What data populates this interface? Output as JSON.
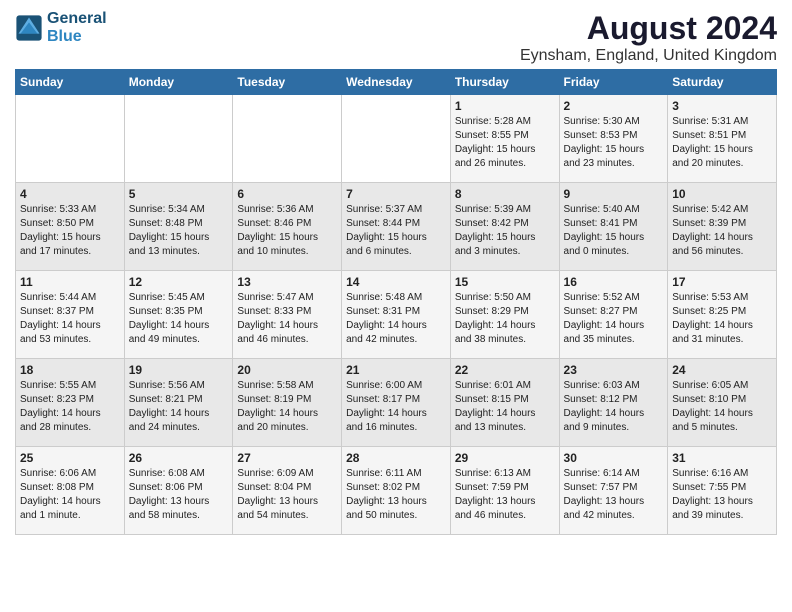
{
  "logo": {
    "line1": "General",
    "line2": "Blue"
  },
  "title": "August 2024",
  "subtitle": "Eynsham, England, United Kingdom",
  "days_of_week": [
    "Sunday",
    "Monday",
    "Tuesday",
    "Wednesday",
    "Thursday",
    "Friday",
    "Saturday"
  ],
  "weeks": [
    [
      {
        "day": "",
        "info": ""
      },
      {
        "day": "",
        "info": ""
      },
      {
        "day": "",
        "info": ""
      },
      {
        "day": "",
        "info": ""
      },
      {
        "day": "1",
        "info": "Sunrise: 5:28 AM\nSunset: 8:55 PM\nDaylight: 15 hours\nand 26 minutes."
      },
      {
        "day": "2",
        "info": "Sunrise: 5:30 AM\nSunset: 8:53 PM\nDaylight: 15 hours\nand 23 minutes."
      },
      {
        "day": "3",
        "info": "Sunrise: 5:31 AM\nSunset: 8:51 PM\nDaylight: 15 hours\nand 20 minutes."
      }
    ],
    [
      {
        "day": "4",
        "info": "Sunrise: 5:33 AM\nSunset: 8:50 PM\nDaylight: 15 hours\nand 17 minutes."
      },
      {
        "day": "5",
        "info": "Sunrise: 5:34 AM\nSunset: 8:48 PM\nDaylight: 15 hours\nand 13 minutes."
      },
      {
        "day": "6",
        "info": "Sunrise: 5:36 AM\nSunset: 8:46 PM\nDaylight: 15 hours\nand 10 minutes."
      },
      {
        "day": "7",
        "info": "Sunrise: 5:37 AM\nSunset: 8:44 PM\nDaylight: 15 hours\nand 6 minutes."
      },
      {
        "day": "8",
        "info": "Sunrise: 5:39 AM\nSunset: 8:42 PM\nDaylight: 15 hours\nand 3 minutes."
      },
      {
        "day": "9",
        "info": "Sunrise: 5:40 AM\nSunset: 8:41 PM\nDaylight: 15 hours\nand 0 minutes."
      },
      {
        "day": "10",
        "info": "Sunrise: 5:42 AM\nSunset: 8:39 PM\nDaylight: 14 hours\nand 56 minutes."
      }
    ],
    [
      {
        "day": "11",
        "info": "Sunrise: 5:44 AM\nSunset: 8:37 PM\nDaylight: 14 hours\nand 53 minutes."
      },
      {
        "day": "12",
        "info": "Sunrise: 5:45 AM\nSunset: 8:35 PM\nDaylight: 14 hours\nand 49 minutes."
      },
      {
        "day": "13",
        "info": "Sunrise: 5:47 AM\nSunset: 8:33 PM\nDaylight: 14 hours\nand 46 minutes."
      },
      {
        "day": "14",
        "info": "Sunrise: 5:48 AM\nSunset: 8:31 PM\nDaylight: 14 hours\nand 42 minutes."
      },
      {
        "day": "15",
        "info": "Sunrise: 5:50 AM\nSunset: 8:29 PM\nDaylight: 14 hours\nand 38 minutes."
      },
      {
        "day": "16",
        "info": "Sunrise: 5:52 AM\nSunset: 8:27 PM\nDaylight: 14 hours\nand 35 minutes."
      },
      {
        "day": "17",
        "info": "Sunrise: 5:53 AM\nSunset: 8:25 PM\nDaylight: 14 hours\nand 31 minutes."
      }
    ],
    [
      {
        "day": "18",
        "info": "Sunrise: 5:55 AM\nSunset: 8:23 PM\nDaylight: 14 hours\nand 28 minutes."
      },
      {
        "day": "19",
        "info": "Sunrise: 5:56 AM\nSunset: 8:21 PM\nDaylight: 14 hours\nand 24 minutes."
      },
      {
        "day": "20",
        "info": "Sunrise: 5:58 AM\nSunset: 8:19 PM\nDaylight: 14 hours\nand 20 minutes."
      },
      {
        "day": "21",
        "info": "Sunrise: 6:00 AM\nSunset: 8:17 PM\nDaylight: 14 hours\nand 16 minutes."
      },
      {
        "day": "22",
        "info": "Sunrise: 6:01 AM\nSunset: 8:15 PM\nDaylight: 14 hours\nand 13 minutes."
      },
      {
        "day": "23",
        "info": "Sunrise: 6:03 AM\nSunset: 8:12 PM\nDaylight: 14 hours\nand 9 minutes."
      },
      {
        "day": "24",
        "info": "Sunrise: 6:05 AM\nSunset: 8:10 PM\nDaylight: 14 hours\nand 5 minutes."
      }
    ],
    [
      {
        "day": "25",
        "info": "Sunrise: 6:06 AM\nSunset: 8:08 PM\nDaylight: 14 hours\nand 1 minute."
      },
      {
        "day": "26",
        "info": "Sunrise: 6:08 AM\nSunset: 8:06 PM\nDaylight: 13 hours\nand 58 minutes."
      },
      {
        "day": "27",
        "info": "Sunrise: 6:09 AM\nSunset: 8:04 PM\nDaylight: 13 hours\nand 54 minutes."
      },
      {
        "day": "28",
        "info": "Sunrise: 6:11 AM\nSunset: 8:02 PM\nDaylight: 13 hours\nand 50 minutes."
      },
      {
        "day": "29",
        "info": "Sunrise: 6:13 AM\nSunset: 7:59 PM\nDaylight: 13 hours\nand 46 minutes."
      },
      {
        "day": "30",
        "info": "Sunrise: 6:14 AM\nSunset: 7:57 PM\nDaylight: 13 hours\nand 42 minutes."
      },
      {
        "day": "31",
        "info": "Sunrise: 6:16 AM\nSunset: 7:55 PM\nDaylight: 13 hours\nand 39 minutes."
      }
    ]
  ]
}
